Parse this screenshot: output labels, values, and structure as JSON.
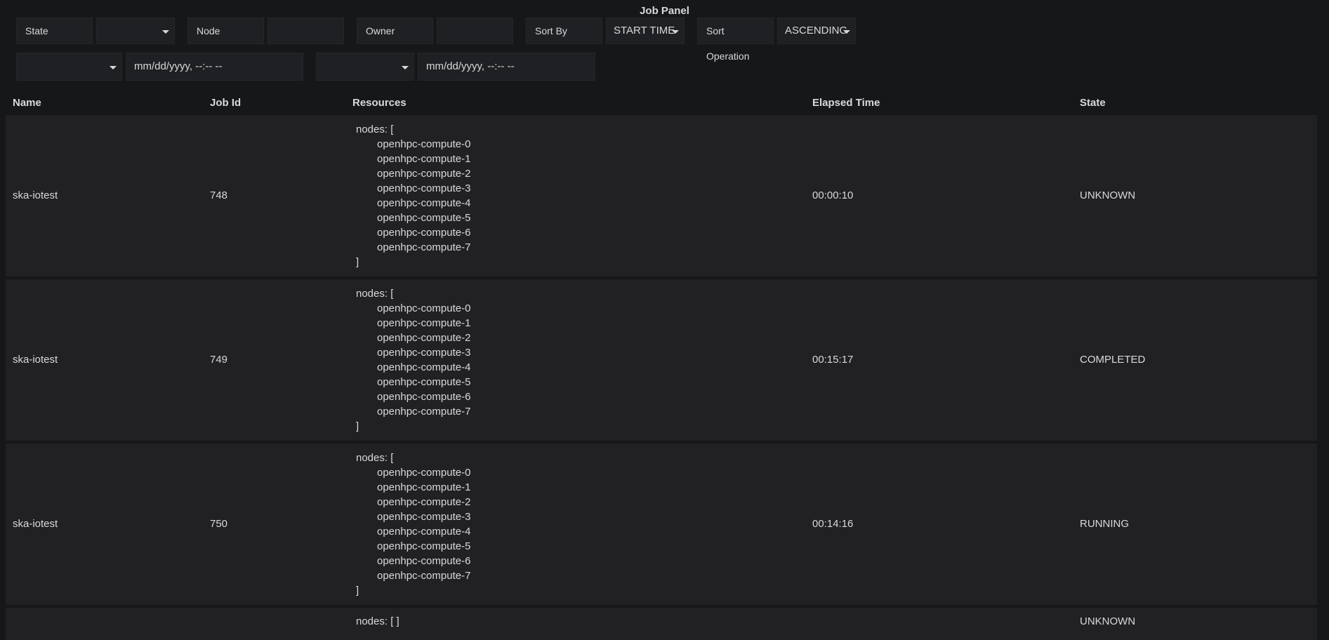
{
  "panel": {
    "title": "Job Panel"
  },
  "filters": {
    "state_label": "State",
    "state_value": "",
    "node_label": "Node",
    "node_value": "",
    "owner_label": "Owner",
    "owner_value": "",
    "sortby_label": "Sort By",
    "sortby_value": "START TIME",
    "sortop_label": "Sort Operation",
    "sortop_value": "ASCENDING"
  },
  "dates": {
    "from_select": "",
    "from_placeholder": "mm/dd/yyyy, --:-- --",
    "to_select": "",
    "to_placeholder": "mm/dd/yyyy, --:-- --"
  },
  "table": {
    "columns": [
      "Name",
      "Job Id",
      "Resources",
      "Elapsed Time",
      "State"
    ],
    "rows": [
      {
        "name": "ska-iotest",
        "job_id": "748",
        "elapsed": "00:00:10",
        "state": "UNKNOWN",
        "res_open": "nodes: [",
        "res_close": "]",
        "nodes": [
          "openhpc-compute-0",
          "openhpc-compute-1",
          "openhpc-compute-2",
          "openhpc-compute-3",
          "openhpc-compute-4",
          "openhpc-compute-5",
          "openhpc-compute-6",
          "openhpc-compute-7"
        ]
      },
      {
        "name": "ska-iotest",
        "job_id": "749",
        "elapsed": "00:15:17",
        "state": "COMPLETED",
        "res_open": "nodes: [",
        "res_close": "]",
        "nodes": [
          "openhpc-compute-0",
          "openhpc-compute-1",
          "openhpc-compute-2",
          "openhpc-compute-3",
          "openhpc-compute-4",
          "openhpc-compute-5",
          "openhpc-compute-6",
          "openhpc-compute-7"
        ]
      },
      {
        "name": "ska-iotest",
        "job_id": "750",
        "elapsed": "00:14:16",
        "state": "RUNNING",
        "res_open": "nodes: [",
        "res_close": "]",
        "nodes": [
          "openhpc-compute-0",
          "openhpc-compute-1",
          "openhpc-compute-2",
          "openhpc-compute-3",
          "openhpc-compute-4",
          "openhpc-compute-5",
          "openhpc-compute-6",
          "openhpc-compute-7"
        ]
      },
      {
        "name": "",
        "job_id": "",
        "elapsed": "",
        "state": "UNKNOWN",
        "res_open": "nodes: [ ]",
        "res_close": "",
        "nodes": []
      }
    ]
  },
  "colors": {
    "background": "#161719",
    "row": "#212124",
    "input": "#1f2023",
    "text": "#d8d9da"
  }
}
